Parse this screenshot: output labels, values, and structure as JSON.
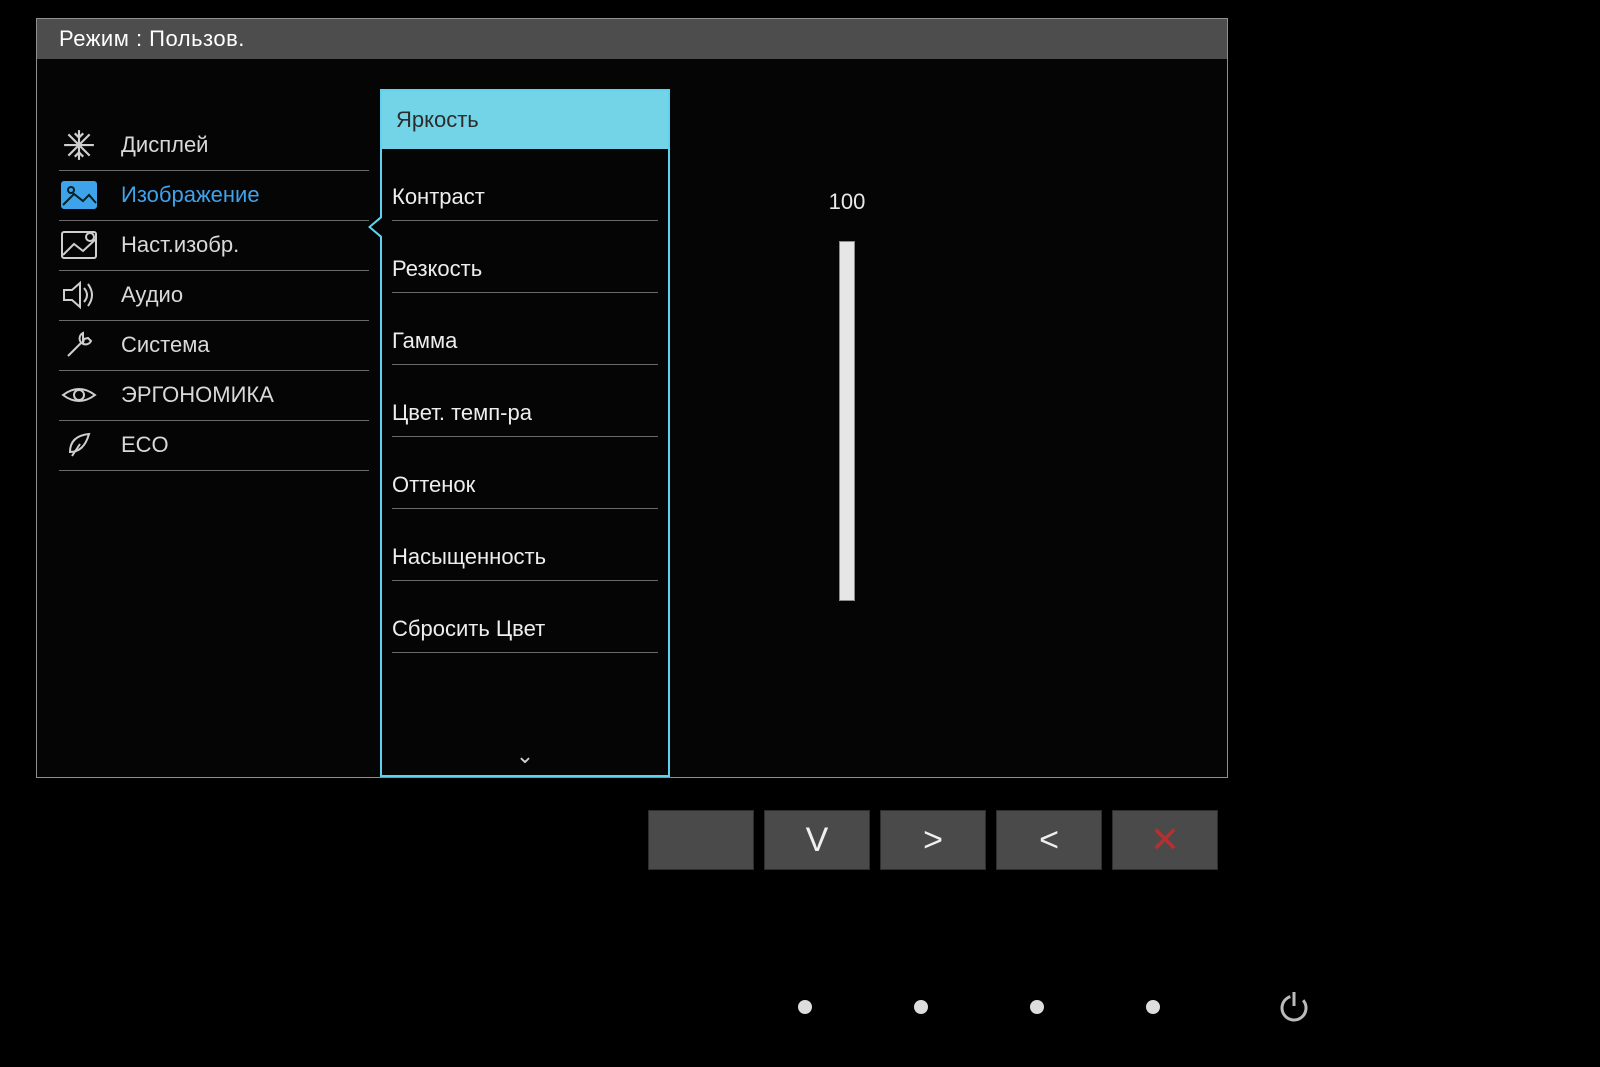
{
  "header": {
    "title": "Режим : Пользов."
  },
  "sidebar": {
    "items": [
      {
        "label": "Дисплей",
        "icon": "snowflake-icon"
      },
      {
        "label": "Изображение",
        "icon": "picture-icon",
        "active": true
      },
      {
        "label": "Наст.изобр.",
        "icon": "picture-gear-icon"
      },
      {
        "label": "Аудио",
        "icon": "speaker-icon"
      },
      {
        "label": "Система",
        "icon": "wrench-icon"
      },
      {
        "label": "ЭРГОНОМИКА",
        "icon": "eye-icon"
      },
      {
        "label": "ECO",
        "icon": "leaf-icon"
      }
    ]
  },
  "submenu": {
    "items": [
      {
        "label": "Яркость",
        "selected": true
      },
      {
        "label": "Контраст"
      },
      {
        "label": "Резкость"
      },
      {
        "label": "Гамма"
      },
      {
        "label": "Цвет. темп-ра"
      },
      {
        "label": "Оттенок"
      },
      {
        "label": "Насыщенность"
      },
      {
        "label": "Сбросить Цвет"
      }
    ],
    "more_indicator": "⌄"
  },
  "value": {
    "current": "100",
    "percent": 100
  },
  "buttons": {
    "blank": "",
    "down": "V",
    "right": ">",
    "left": "<",
    "close": "✕"
  },
  "colors": {
    "accent": "#5ed2ee",
    "accent_text": "#3fa3ec",
    "close_red": "#b53030"
  }
}
